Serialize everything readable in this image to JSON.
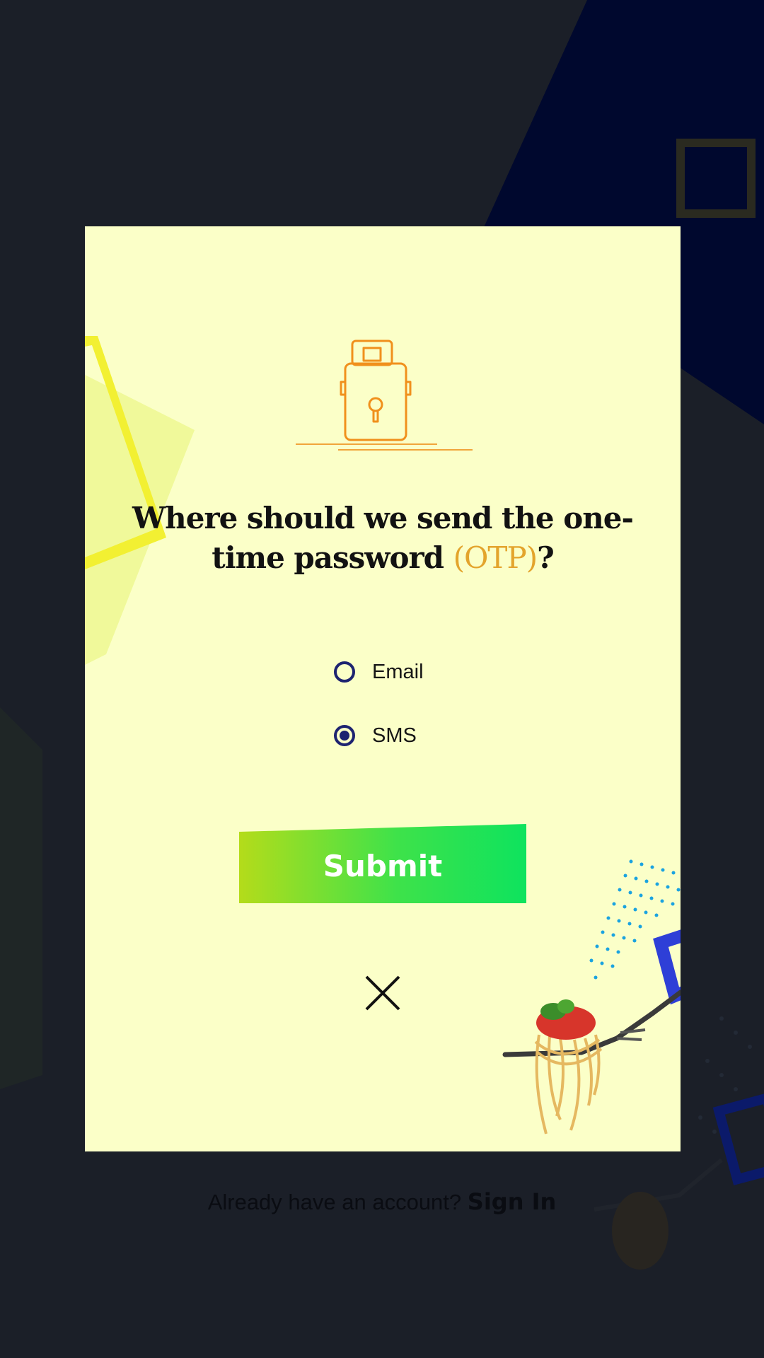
{
  "modal": {
    "question_prefix": "Where should we send the one-time password ",
    "question_otp": "(OTP)",
    "question_suffix": "?",
    "options": [
      {
        "label": "Email",
        "selected": false
      },
      {
        "label": "SMS",
        "selected": true
      }
    ],
    "submit_label": "Submit",
    "close_icon": "close-icon",
    "lock_icon": "lock-icon"
  },
  "background": {
    "footer_text": "Already have an account?",
    "footer_link": "Sign In"
  },
  "colors": {
    "card": "#fbffc8",
    "accent_otp": "#e3a42c",
    "radio": "#1d2370",
    "submit_start": "#b4dc1a",
    "submit_end": "#0ee35e",
    "background": "#1b1f28"
  }
}
